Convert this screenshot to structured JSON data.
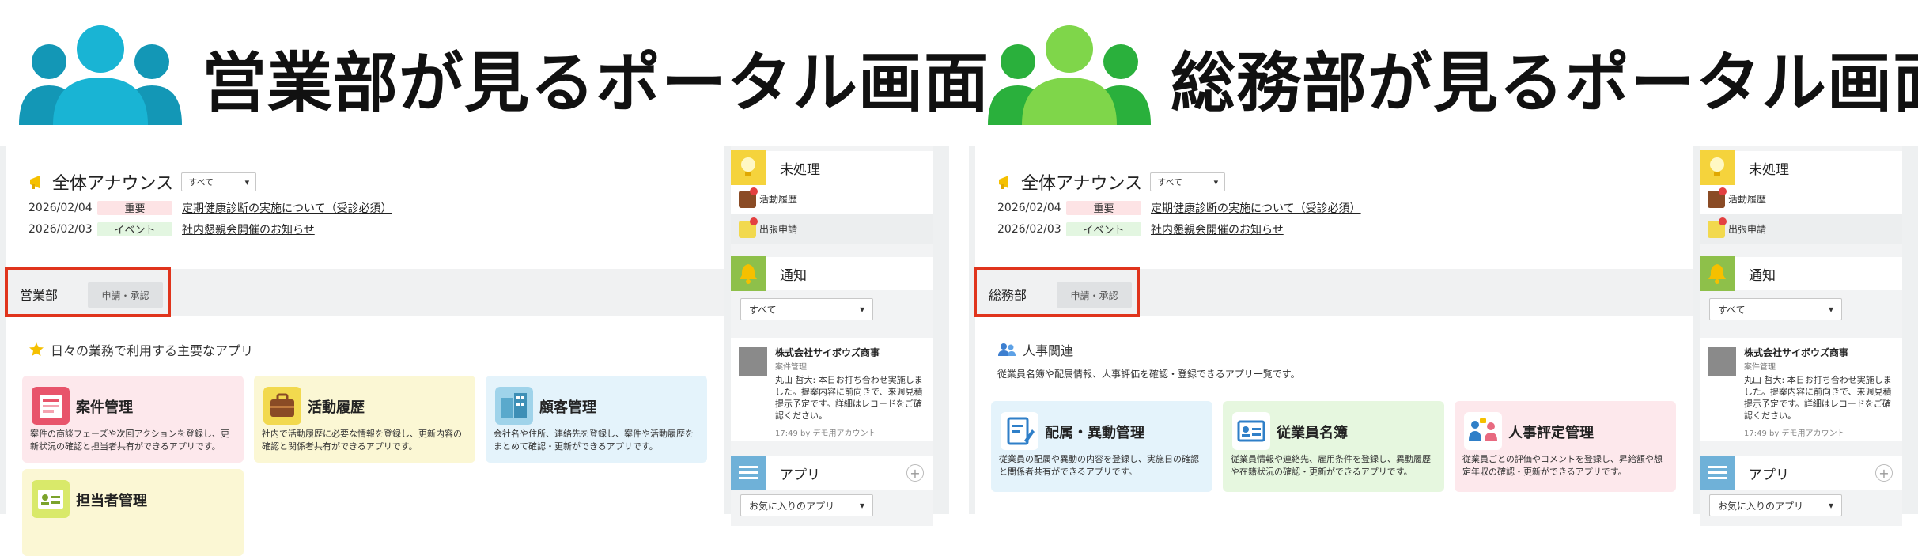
{
  "left": {
    "title": "営業部が見るポータル画面",
    "accent": "#1aa6c4",
    "announcement": {
      "title": "全体アナウンス",
      "filter": "すべて",
      "rows": [
        {
          "date": "2026/02/04",
          "tag": "重要",
          "text": "定期健康診断の実施について（受診必須）"
        },
        {
          "date": "2026/02/03",
          "tag": "イベント",
          "text": "社内懇親会開催のお知らせ"
        }
      ]
    },
    "tabs": {
      "active": "営業部",
      "other": "申請・承認"
    },
    "section": {
      "title": "日々の業務で利用する主要なアプリ"
    },
    "apps": [
      {
        "name": "案件管理",
        "desc": "案件の商談フェーズや次回アクションを登録し、更新状況の確認と担当者共有ができるアプリです。",
        "bg": "#fde8ec",
        "icon": "case-icon"
      },
      {
        "name": "活動履歴",
        "desc": "社内で活動履歴に必要な情報を登録し、更新内容の確認と関係者共有ができるアプリです。",
        "bg": "#fbf7d4",
        "icon": "briefcase-icon"
      },
      {
        "name": "顧客管理",
        "desc": "会社名や住所、連絡先を登録し、案件や活動履歴をまとめて確認・更新ができるアプリです。",
        "bg": "#e4f3fb",
        "icon": "building-icon"
      },
      {
        "name": "担当者管理",
        "desc": "",
        "bg": "#fbf7d4",
        "icon": "person-card-icon"
      }
    ],
    "side": {
      "pending": {
        "title": "未処理",
        "items": [
          "活動履歴",
          "出張申請"
        ]
      },
      "notice": {
        "title": "通知",
        "filter": "すべて",
        "company": "株式会社サイボウズ商事",
        "app": "案件管理",
        "body": "丸山 哲大: 本日お打ち合わせ実施しました。提案内容に前向きで、来週見積提示予定です。詳細はレコードをご確認ください。",
        "time": "17:49  by デモ用アカウント"
      },
      "apps": {
        "title": "アプリ",
        "filter": "お気に入りのアプリ"
      }
    }
  },
  "right": {
    "title": "総務部が見るポータル画面",
    "accent": "#3cc24a",
    "announcement": {
      "title": "全体アナウンス",
      "filter": "すべて",
      "rows": [
        {
          "date": "2026/02/04",
          "tag": "重要",
          "text": "定期健康診断の実施について（受診必須）"
        },
        {
          "date": "2026/02/03",
          "tag": "イベント",
          "text": "社内懇親会開催のお知らせ"
        }
      ]
    },
    "tabs": {
      "active": "総務部",
      "other": "申請・承認"
    },
    "section": {
      "title": "人事関連",
      "desc": "従業員名簿や配属情報、人事評価を確認・登録できるアプリ一覧です。"
    },
    "apps": [
      {
        "name": "配属・異動管理",
        "desc": "従業員の配属や異動の内容を登録し、実施日の確認と関係者共有ができるアプリです。",
        "bg": "#e4f3fb",
        "icon": "document-pen-icon"
      },
      {
        "name": "従業員名簿",
        "desc": "従業員情報や連絡先、雇用条件を登録し、異動履歴や在籍状況の確認・更新ができるアプリです。",
        "bg": "#e6f7df",
        "icon": "id-card-icon"
      },
      {
        "name": "人事評定管理",
        "desc": "従業員ごとの評価やコメントを登録し、昇給額や想定年収の確認・更新ができるアプリです。",
        "bg": "#fde8ec",
        "icon": "people-talk-icon"
      }
    ],
    "side": {
      "pending": {
        "title": "未処理",
        "items": [
          "活動履歴",
          "出張申請"
        ]
      },
      "notice": {
        "title": "通知",
        "filter": "すべて",
        "company": "株式会社サイボウズ商事",
        "app": "案件管理",
        "body": "丸山 哲大: 本日お打ち合わせ実施しました。提案内容に前向きで、来週見積提示予定です。詳細はレコードをご確認ください。",
        "time": "17:49  by デモ用アカウント"
      },
      "apps": {
        "title": "アプリ",
        "filter": "お気に入りのアプリ"
      }
    }
  }
}
